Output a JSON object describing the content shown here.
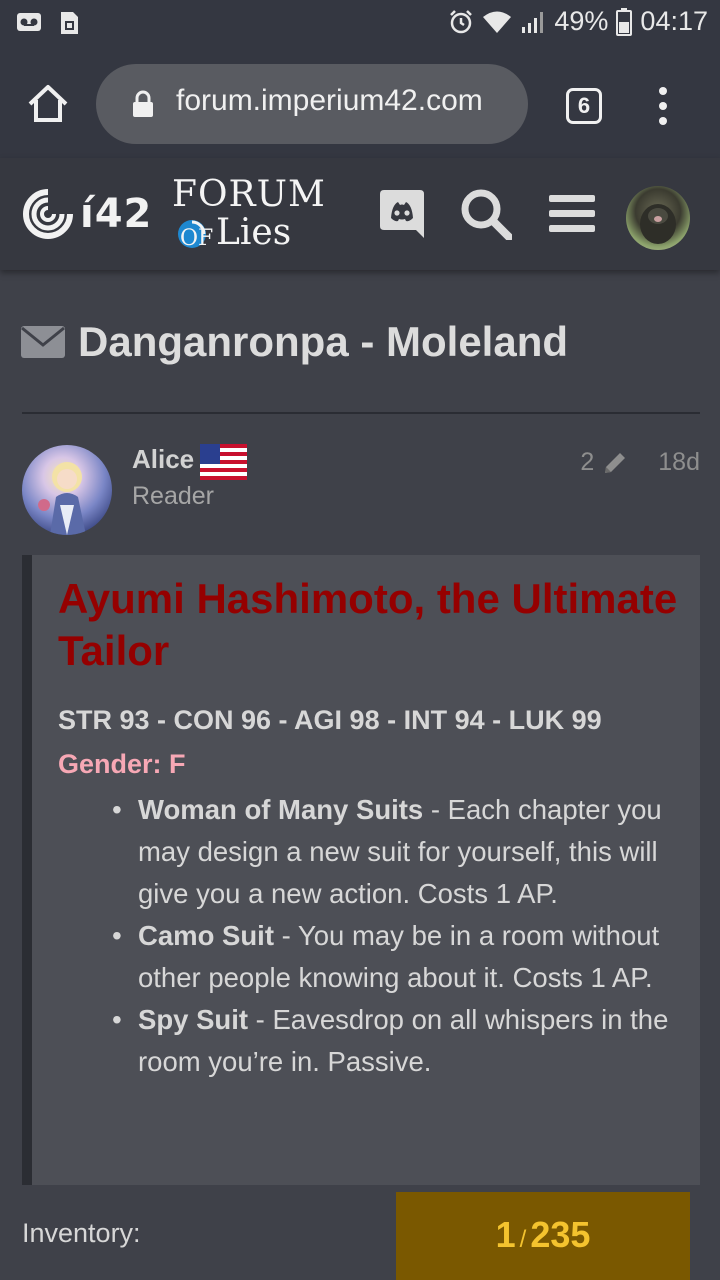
{
  "statusbar": {
    "battery": "49%",
    "time": "04:17"
  },
  "browser": {
    "url": "forum.imperium42.com",
    "tab_count": "6"
  },
  "forum_header": {
    "logo_i42": "í42",
    "logo_forum": "FORUM",
    "logo_of": "OF",
    "logo_lies": "Lies"
  },
  "topic": {
    "title": "Danganronpa - Moleland"
  },
  "post": {
    "username": "Alice",
    "user_title": "Reader",
    "edit_count": "2",
    "age": "18d",
    "quote": {
      "heading": "Ayumi Hashimoto, the Ultimate Tailor",
      "stats": "STR 93 - CON 96 - AGI 98 - INT 94 - LUK 99",
      "gender": "Gender: F",
      "abilities": [
        {
          "name": "Woman of Many Suits",
          "desc": " - Each chapter you may design a new suit for yourself, this will give you a new action. Costs 1 AP."
        },
        {
          "name": "Camo Suit",
          "desc": " - You may be in a room without other people knowing about it. Costs 1 AP."
        },
        {
          "name": "Spy Suit",
          "desc": " - Eavesdrop on all whispers in the room you’re in. Passive."
        }
      ]
    },
    "inventory_label": "Inventory:"
  },
  "progress": {
    "current": "1",
    "separator": "/",
    "total": "235"
  },
  "colors": {
    "background": "#3f4149",
    "quote_bg": "#4d4f56",
    "heading_red": "#950000",
    "gender_pink": "#f7a8b5",
    "progress_bg": "#7a5800",
    "progress_text": "#f4c32e"
  }
}
